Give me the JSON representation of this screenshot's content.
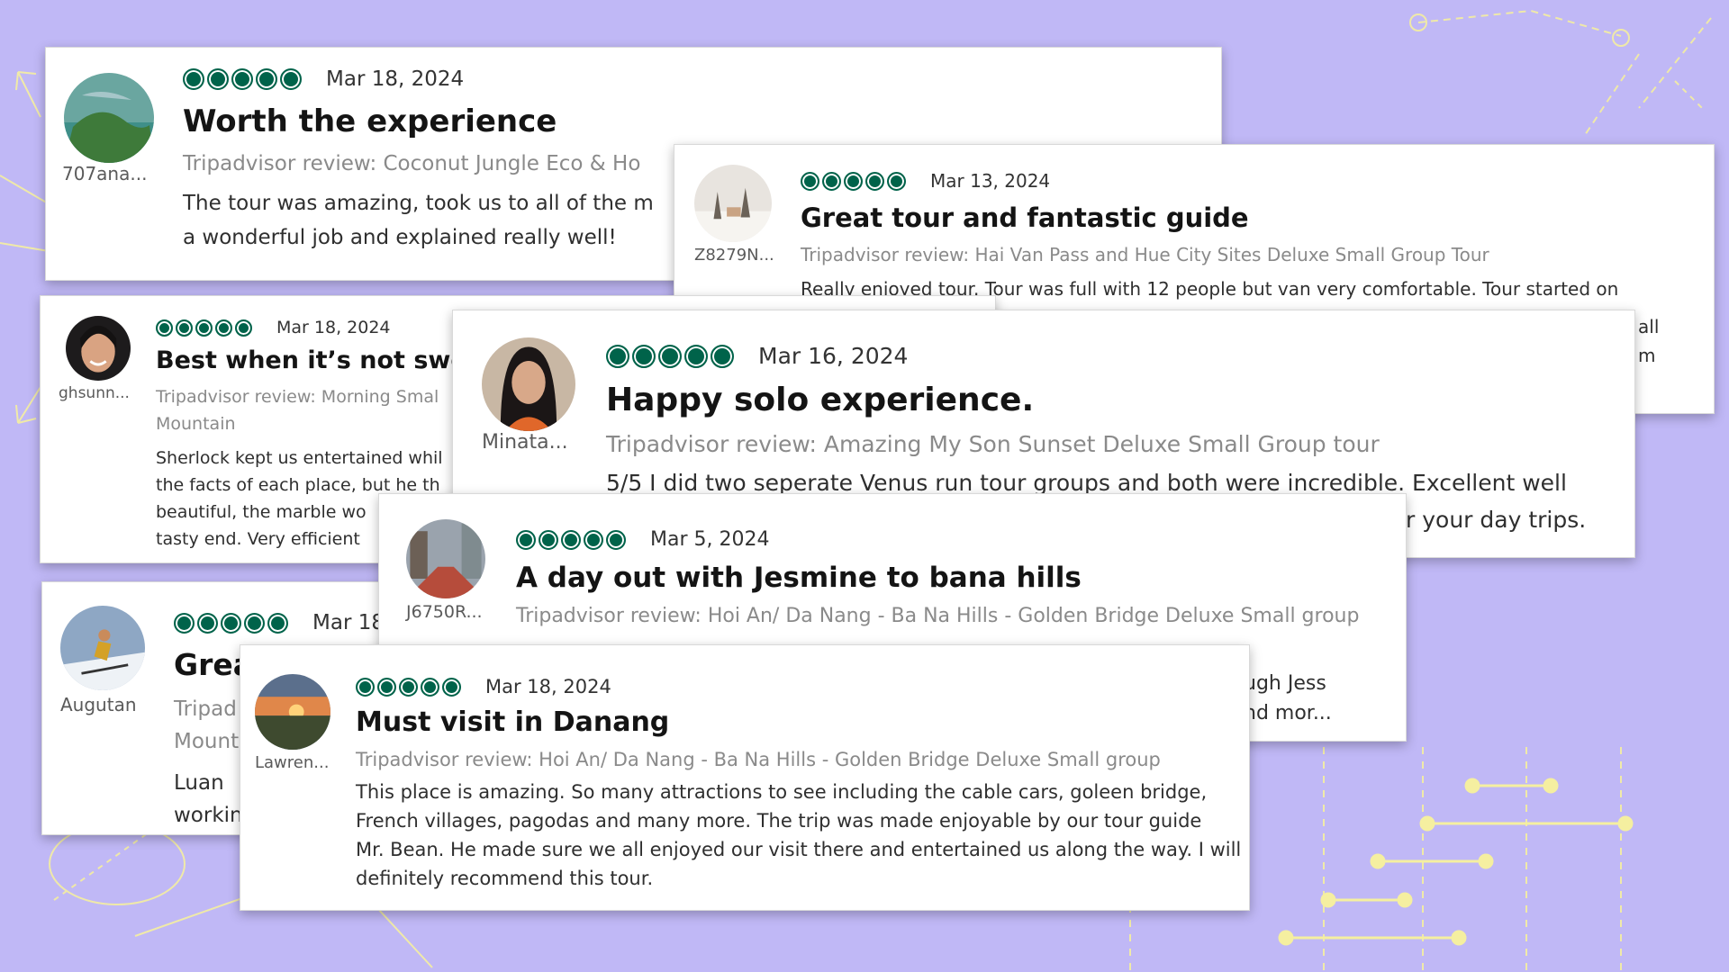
{
  "reviews": [
    {
      "username": "707ana...",
      "date": "Mar 18, 2024",
      "title": "Worth the experience",
      "subtitle": "Tripadvisor review: Coconut Jungle Eco & Ho",
      "body": "The tour was amazing, took us to all of the m\na wonderful job and explained really well!",
      "rating": 5
    },
    {
      "username": "Z8279N...",
      "date": "Mar 13, 2024",
      "title": "Great tour and fantastic guide",
      "subtitle": "Tripadvisor review: Hai Van Pass and Hue City Sites Deluxe Small Group Tour",
      "body": "Really enjoyed tour. Tour was full with 12 people but van very comfortable. Tour started on",
      "tail": "all\nm",
      "rating": 5
    },
    {
      "username": "ghsunn...",
      "date": "Mar 18, 2024",
      "title": "Best when it’s not swelt",
      "subtitle": "Tripadvisor review: Morning Smal\nMountain",
      "body": "Sherlock kept us entertained whil\nthe facts of each place, but he th\nbeautiful, the marble wo\ntasty end. Very efficient",
      "rating": 5
    },
    {
      "username": "Minata...",
      "date": "Mar 16, 2024",
      "title": "Happy solo experience.",
      "subtitle": "Tripadvisor review: Amazing My Son Sunset Deluxe Small Group tour",
      "body": "5/5 I did two seperate Venus run tour groups and both were incredible. Excellent well",
      "tail": "r your day trips.",
      "rating": 5
    },
    {
      "username": "J6750R...",
      "date": "Mar 5, 2024",
      "title": "A day out with Jesmine to bana hills",
      "subtitle": "Tripadvisor review: Hoi An/ Da Nang - Ba Na Hills - Golden Bridge Deluxe Small group",
      "tail": "ugh Jess\nnd mor...",
      "rating": 5
    },
    {
      "username": "Augutan",
      "date": "Mar 18",
      "title": "Grea",
      "subtitle": "Tripad\nMount",
      "body": "Luan \nworkin",
      "rating": 5
    },
    {
      "username": "Lawren...",
      "date": "Mar 18, 2024",
      "title": "Must visit in Danang",
      "subtitle": "Tripadvisor review: Hoi An/ Da Nang - Ba Na Hills - Golden Bridge Deluxe Small group",
      "body": "This place is amazing. So many attractions to see including the cable cars, goleen bridge,\nFrench villages, pagodas and many more. The trip was made enjoyable by our tour guide\nMr. Bean. He made sure we all enjoyed our visit there and entertained us along the way. I will\ndefinitely recommend this tour.",
      "rating": 5
    }
  ],
  "icons": {
    "rating": "rating-bubbles-icon",
    "avatars": [
      "island-photo",
      "snowy-landscape-photo",
      "woman-smiling-photo",
      "woman-dark-hair-photo",
      "city-street-photo",
      "skier-photo",
      "sunset-field-photo"
    ]
  },
  "colors": {
    "background": "#c0b8f6",
    "rating": "#00634a",
    "decoration": "#f5efa0"
  }
}
